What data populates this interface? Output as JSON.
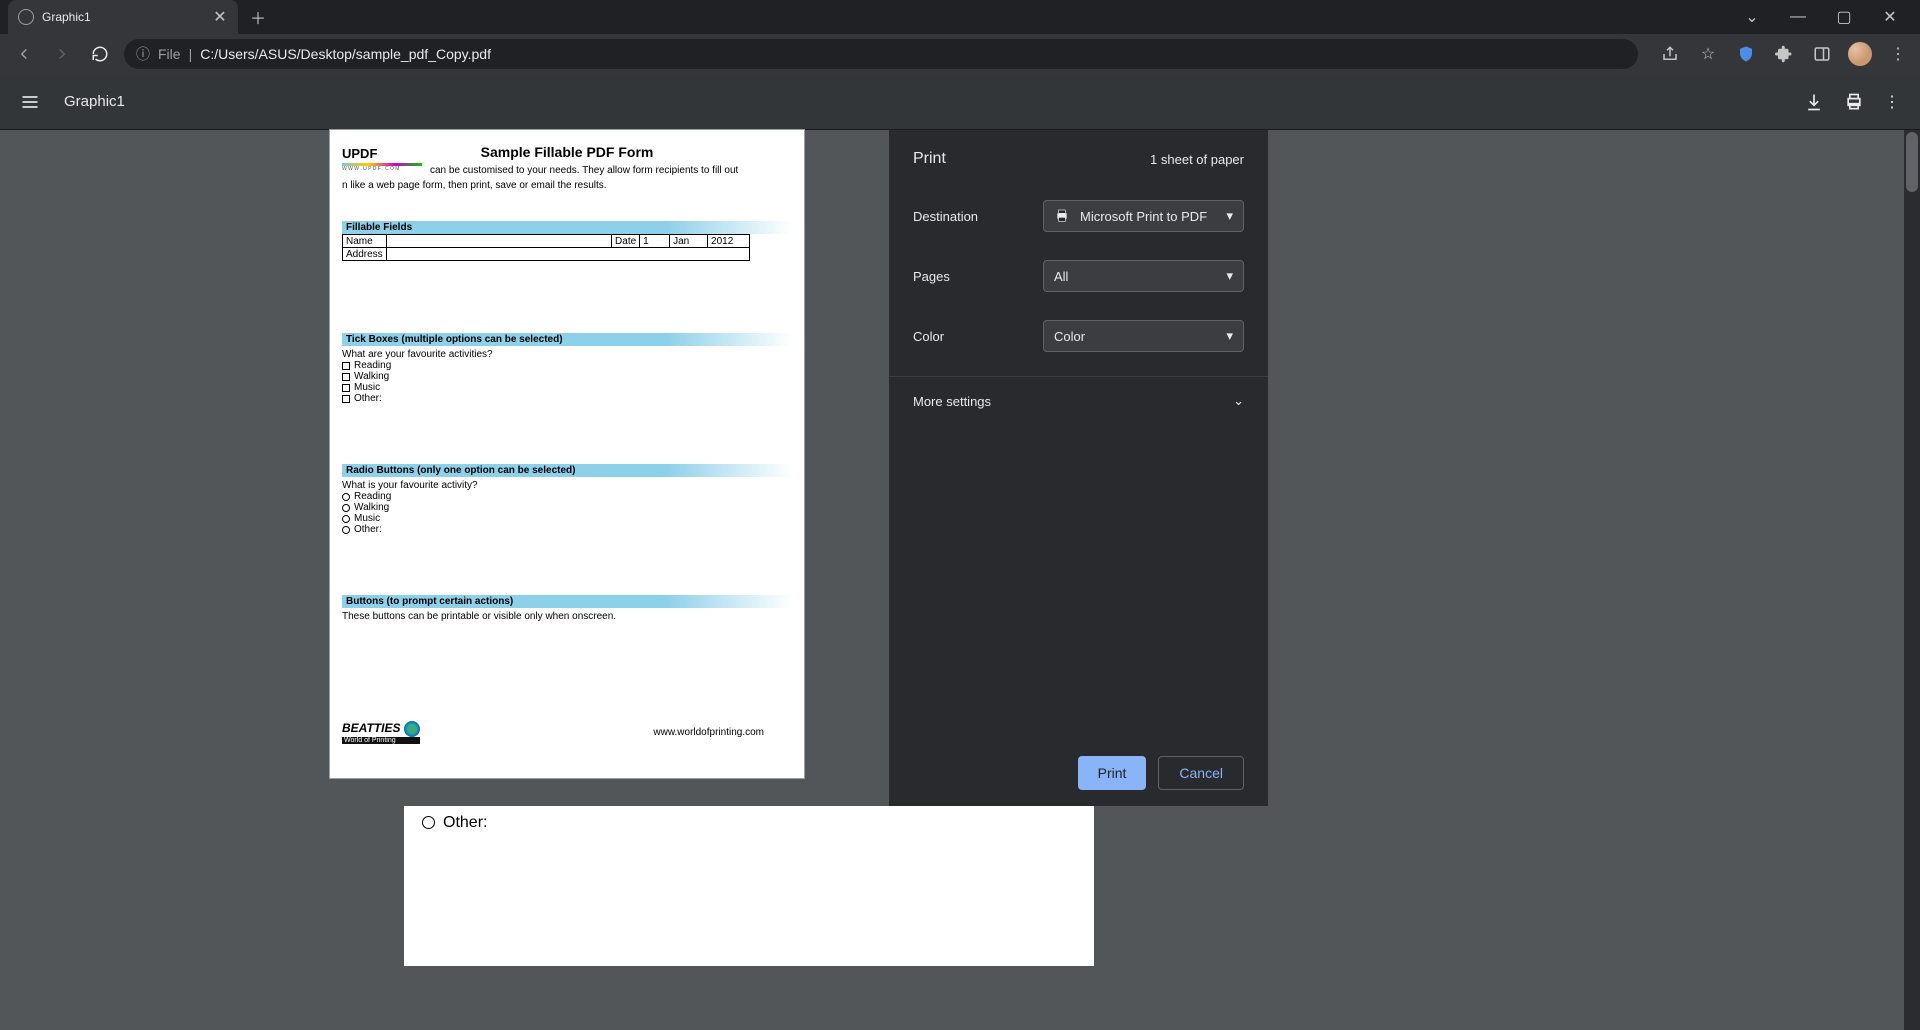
{
  "browser": {
    "tab_title": "Graphic1",
    "url_scheme_label": "File",
    "url_path": "C:/Users/ASUS/Desktop/sample_pdf_Copy.pdf"
  },
  "pdfbar": {
    "doc_name": "Graphic1"
  },
  "preview": {
    "title": "Sample Fillable PDF Form",
    "logo_text": "UPDF",
    "logo_sub": "W W W . U P D F . C O M",
    "intro_line1": "can be customised to your needs. They allow form recipients to fill out",
    "intro_line2": "n like a web page form, then print, save or email the results.",
    "sec_fillable": "Fillable Fields",
    "lbl_name": "Name",
    "lbl_date": "Date",
    "val_day": "1",
    "val_month": "Jan",
    "val_year": "2012",
    "lbl_address": "Address",
    "sec_tick": "Tick Boxes (multiple options can be selected)",
    "q_tick": "What are your favourite activities?",
    "opt_reading": "Reading",
    "opt_walking": "Walking",
    "opt_music": "Music",
    "opt_other": "Other:",
    "sec_radio": "Radio Buttons (only one option can be selected)",
    "q_radio": "What is your favourite activity?",
    "sec_buttons": "Buttons (to prompt certain actions)",
    "buttons_text": "These buttons can be printable or visible only when onscreen.",
    "footer_brand": "BEATTIES",
    "footer_brand_sub": "World of Printing",
    "footer_url": "www.worldofprinting.com"
  },
  "under": {
    "other": "Other:"
  },
  "print": {
    "title": "Print",
    "sheets": "1 sheet of paper",
    "lbl_destination": "Destination",
    "val_destination": "Microsoft Print to PDF",
    "lbl_pages": "Pages",
    "val_pages": "All",
    "lbl_color": "Color",
    "val_color": "Color",
    "more": "More settings",
    "btn_print": "Print",
    "btn_cancel": "Cancel"
  }
}
